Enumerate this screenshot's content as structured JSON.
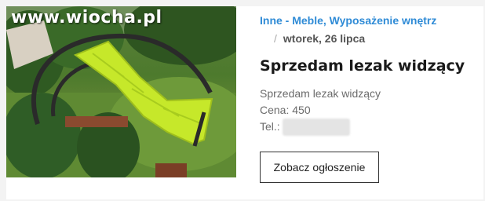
{
  "listing": {
    "watermark": "www.wiocha.pl",
    "category": "Inne - Meble, Wyposażenie wnętrz",
    "separator": "/",
    "date": "wtorek, 26 lipca",
    "title": "Sprzedam lezak widzący",
    "description": "Sprzedam lezak widzący",
    "price_line": "Cena: 450",
    "phone_label": "Tel.:",
    "button_label": "Zobacz ogłoszenie"
  }
}
